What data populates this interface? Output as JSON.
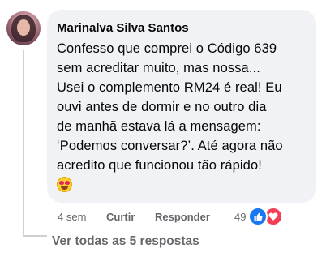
{
  "comment": {
    "author": "Marinalva Silva Santos",
    "text": "Confesso que comprei o Código 639\nsem acreditar muito, mas nossa...\nUsei o complemento RM24 é real! Eu\nouvi antes de dormir e no outro dia\nde manhã estava lá a mensagem:\n‘Podemos conversar?’. Até agora não\nacredito que funcionou tão rápido!",
    "emoji": "heart-eyes-emoji"
  },
  "actions": {
    "time": "4 sem",
    "like_label": "Curtir",
    "reply_label": "Responder"
  },
  "reactions": {
    "count": "49",
    "types": [
      "like",
      "love"
    ],
    "colors": {
      "like": "#1877f2",
      "love": "#f33e58"
    }
  },
  "replies": {
    "view_all_label": "Ver todas as 5 respostas"
  }
}
